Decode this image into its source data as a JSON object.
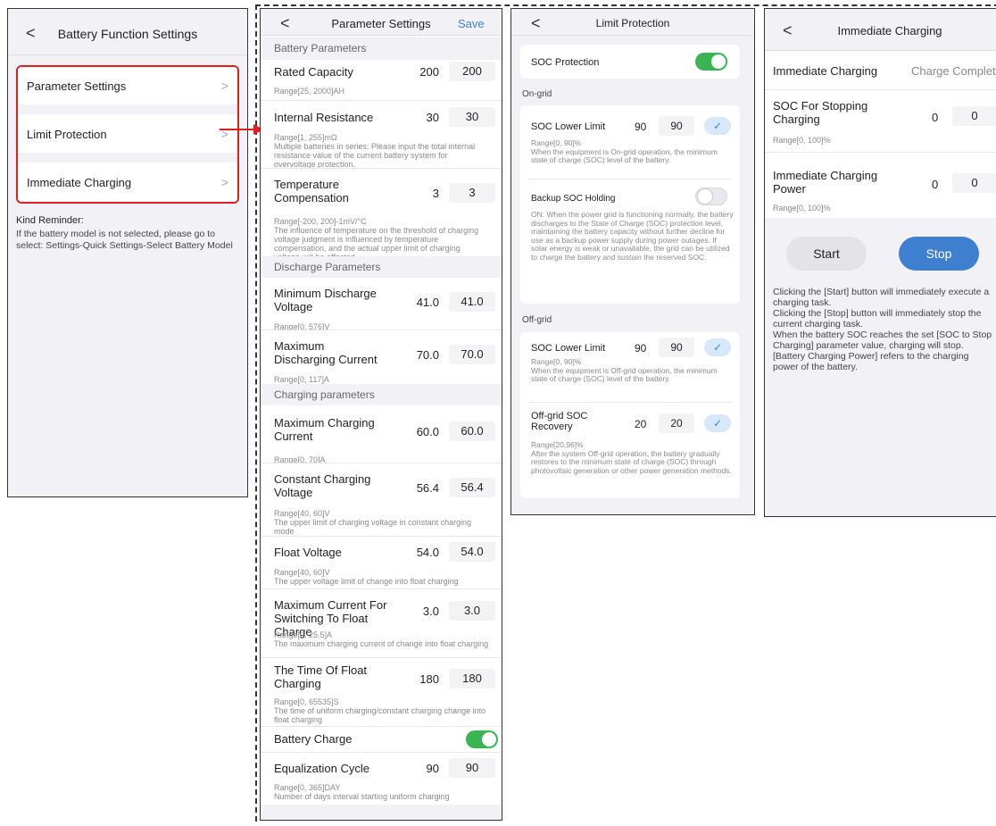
{
  "screen1": {
    "title": "Battery Function Settings",
    "back": "<",
    "items": [
      {
        "label": "Parameter Settings"
      },
      {
        "label": "Limit Protection"
      },
      {
        "label": "Immediate Charging"
      }
    ],
    "chevron": ">",
    "reminder_title": "Kind Reminder:",
    "reminder_text": "If the battery model is not selected, please go to select: Settings-Quick Settings-Select Battery Model"
  },
  "screen2": {
    "back": "<",
    "title": "Parameter Settings",
    "save": "Save",
    "section_battery": "Battery Parameters",
    "section_discharge": "Discharge Parameters",
    "section_charging": "Charging parameters",
    "rows": [
      {
        "label": "Rated Capacity",
        "value": "200",
        "input": "200",
        "hint": "Range[25, 2000]AH"
      },
      {
        "label": "Internal Resistance",
        "value": "30",
        "input": "30",
        "hint": "Range[1, 255]mΩ\nMultiple batteries in series: Please input the total internal resistance value of the current battery system for overvoltage protection."
      },
      {
        "label": "Temperature Compensation",
        "value": "3",
        "input": "3",
        "hint": "Range[-200, 200]-1mV/°C\nThe influence of temperature on the threshold of charging voltage judgment is influenced by temperature compensation, and the actual upper limit of charging voltage will be affected."
      },
      {
        "label": "Minimum Discharge Voltage",
        "value": "41.0",
        "input": "41.0",
        "hint": "Range[0, 576]V"
      },
      {
        "label": "Maximum Discharging Current",
        "value": "70.0",
        "input": "70.0",
        "hint": "Range[0, 117]A"
      },
      {
        "label": "Maximum Charging Current",
        "value": "60.0",
        "input": "60.0",
        "hint": "Range[0, 70]A"
      },
      {
        "label": "Constant Charging Voltage",
        "value": "56.4",
        "input": "56.4",
        "hint": "Range[40, 60]V\nThe upper limit of charging voltage in constant charging mode"
      },
      {
        "label": "Float Voltage",
        "value": "54.0",
        "input": "54.0",
        "hint": "Range[40, 60]V\nThe upper voltage limit of change into float charging"
      },
      {
        "label": "Maximum Current For Switching To Float Charge",
        "value": "3.0",
        "input": "3.0",
        "hint": "Range[0, 25.5]A\nThe maximum charging current of change into float charging"
      },
      {
        "label": "The Time Of  Float Charging",
        "value": "180",
        "input": "180",
        "hint": "Range[0, 65535]S\nThe time of uniform charging/constant charging change into float charging"
      },
      {
        "label": "Battery Charge"
      },
      {
        "label": "Equalization Cycle",
        "value": "90",
        "input": "90",
        "hint": "Range[0, 365]DAY\nNumber of days interval starting uniform charging"
      }
    ]
  },
  "screen3": {
    "back": "<",
    "title": "Limit Protection",
    "soc_protection": "SOC Protection",
    "on_grid": "On-grid",
    "off_grid": "Off-grid",
    "on_lower_label": "SOC Lower Limit",
    "on_lower_value": "90",
    "on_lower_input": "90",
    "on_lower_hint": "Range[0, 90]%\nWhen the equipment is On-grid operation, the minimum state of charge (SOC) level of the battery.",
    "backup_label": "Backup SOC Holding",
    "backup_hint": "ON: When the power grid is functioning normally, the battery discharges to the State of Charge (SOC) protection level, maintaining the battery capacity without further decline for use as a backup power supply during power outages. If solar energy is weak or unavailable, the grid can be utilized to charge the battery and sustain the reserved SOC.",
    "off_lower_label": "SOC Lower Limit",
    "off_lower_value": "90",
    "off_lower_input": "90",
    "off_lower_hint": "Range[0, 90]%\nWhen the equipment is Off-grid operation, the minimum state of charge (SOC) level of the battery.",
    "recovery_label": "Off-grid SOC Recovery",
    "recovery_value": "20",
    "recovery_input": "20",
    "recovery_hint": "Range[20,96]%\nAfter the system Off-grid operation, the battery gradually restores to the minimum state of charge (SOC) through photovoltaic generation or other power generation methods.",
    "check": "✓"
  },
  "screen4": {
    "back": "<",
    "title": "Immediate Charging",
    "status_label": "Immediate Charging",
    "status_value": "Charge Complete",
    "stop_soc_label": "SOC For Stopping Charging",
    "stop_soc_value": "0",
    "stop_soc_input": "0",
    "stop_soc_hint": "Range[0, 100]%",
    "power_label": "Immediate Charging Power",
    "power_value": "0",
    "power_input": "0",
    "power_hint": "Range[0, 100]%",
    "start": "Start",
    "stop": "Stop",
    "note": "Clicking the [Start] button will immediately execute a charging task.\nClicking the [Stop] button will immediately stop the current charging task.\nWhen the battery SOC reaches the set [SOC to Stop Charging] parameter value, charging will stop.\n[Battery Charging Power] refers to the charging power of the battery."
  },
  "colors": {
    "accent": "#3f7fcf",
    "highlight": "#e02020",
    "toggle_on": "#3bb552"
  }
}
